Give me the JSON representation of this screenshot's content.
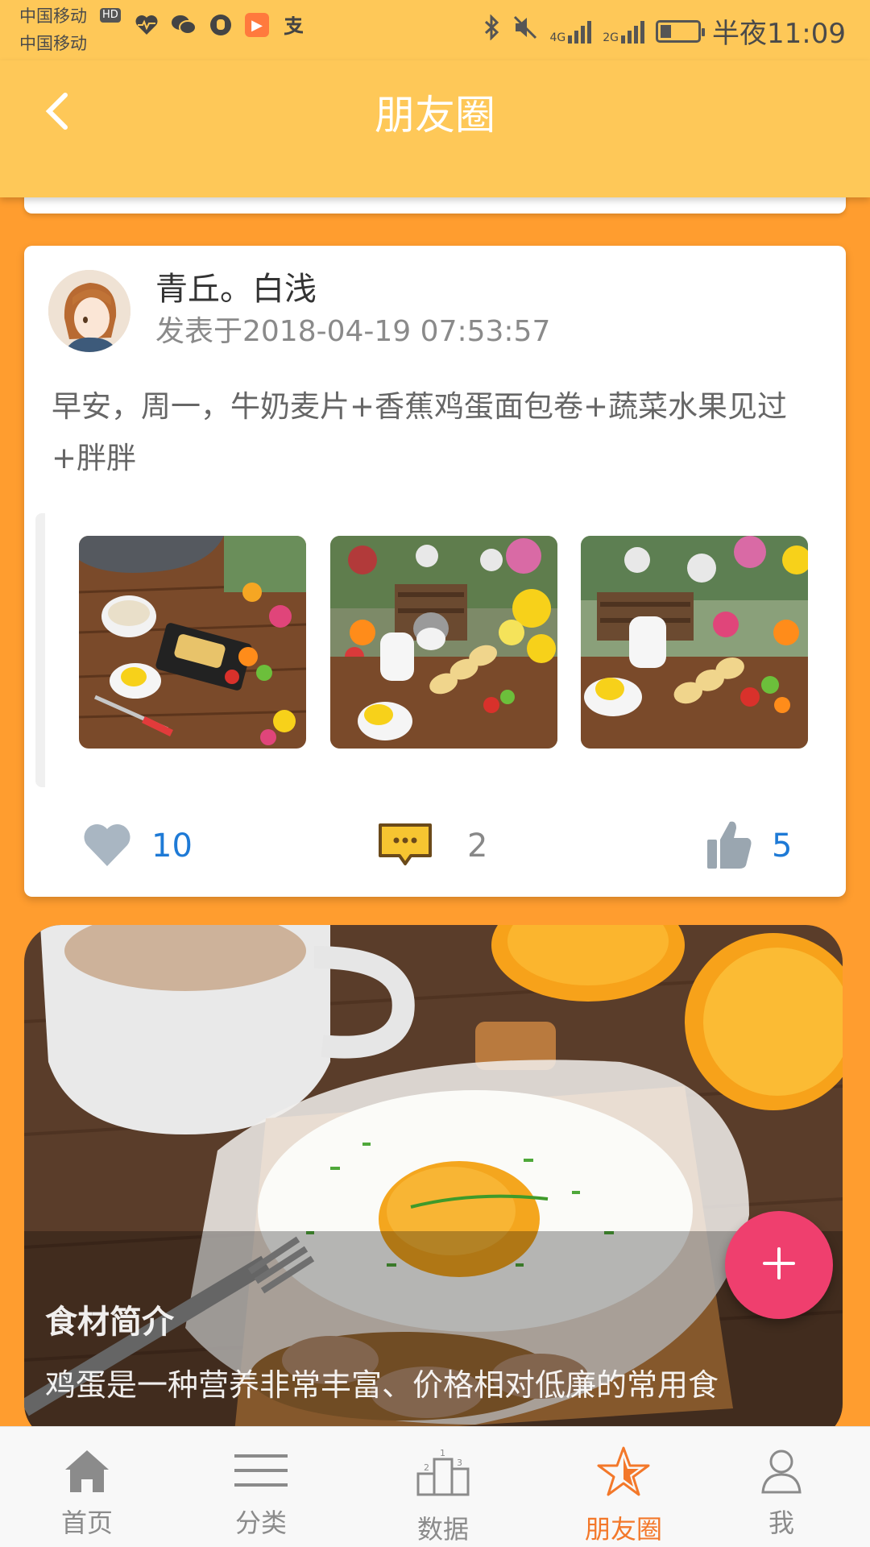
{
  "status_bar": {
    "carrier_1": "中国移动",
    "carrier_2": "中国移动",
    "hd_badge": "HD",
    "signal_4g": "4G",
    "signal_2g": "2G",
    "time": "半夜11:09",
    "battery_level": 0.3,
    "icons": [
      "heart-pulse-icon",
      "wechat-icon",
      "hand-icon",
      "play-icon",
      "alipay-icon",
      "bluetooth-icon",
      "mute-icon"
    ]
  },
  "app_bar": {
    "title": "朋友圈",
    "back_icon": "chevron-left-icon"
  },
  "post": {
    "user_name": "青丘。白浅",
    "time": "发表于2018-04-19 07:53:57",
    "text": "早安，周一，牛奶麦片+香蕉鸡蛋面包卷+蔬菜水果见过+胖胖",
    "images": [
      "breakfast-photo-1",
      "breakfast-photo-2",
      "breakfast-photo-3"
    ],
    "likes": "10",
    "comments": "2",
    "thumbs_up": "5"
  },
  "intro_card": {
    "title": "食材简介",
    "text": "鸡蛋是一种营养非常丰富、价格相对低廉的常用食"
  },
  "fab": {
    "icon": "plus-icon"
  },
  "tab_bar": {
    "items": [
      {
        "label": "首页",
        "icon": "home-icon"
      },
      {
        "label": "分类",
        "icon": "menu-icon"
      },
      {
        "label": "数据",
        "icon": "podium-icon"
      },
      {
        "label": "朋友圈",
        "icon": "star-icon",
        "active": true
      },
      {
        "label": "我",
        "icon": "person-icon"
      }
    ],
    "active_color": "#f3782a",
    "inactive_color": "#8b8b8b"
  },
  "colors": {
    "app_bar": "#fec858",
    "page_background": "#ff9d2f",
    "fab": "#ef3f6e",
    "link_blue": "#1e7ad6"
  }
}
